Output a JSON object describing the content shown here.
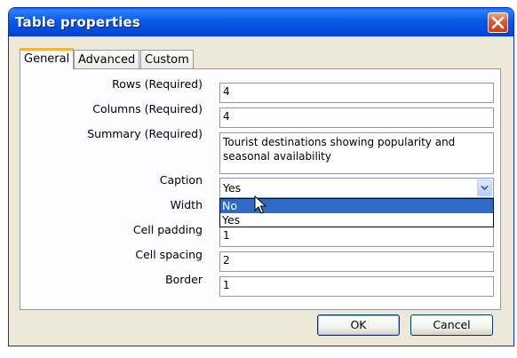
{
  "window": {
    "title": "Table properties"
  },
  "tabs": [
    {
      "label": "General",
      "active": true
    },
    {
      "label": "Advanced",
      "active": false
    },
    {
      "label": "Custom",
      "active": false
    }
  ],
  "form": {
    "rows": {
      "label": "Rows (Required)",
      "value": "4"
    },
    "columns": {
      "label": "Columns (Required)",
      "value": "4"
    },
    "summary": {
      "label": "Summary (Required)",
      "value": "Tourist destinations showing popularity and seasonal availability"
    },
    "caption": {
      "label": "Caption",
      "value": "Yes",
      "options": [
        "No",
        "Yes"
      ],
      "highlighted": "No"
    },
    "width": {
      "label": "Width",
      "value": ""
    },
    "cell_padding": {
      "label": "Cell padding",
      "value": "1"
    },
    "cell_spacing": {
      "label": "Cell spacing",
      "value": "2"
    },
    "border": {
      "label": "Border",
      "value": "1"
    }
  },
  "buttons": {
    "ok": "OK",
    "cancel": "Cancel"
  },
  "colors": {
    "titlebar": "#0a5ae8",
    "accent_tab": "#f5b23f",
    "selection": "#316ac5",
    "close": "#e0552c"
  }
}
